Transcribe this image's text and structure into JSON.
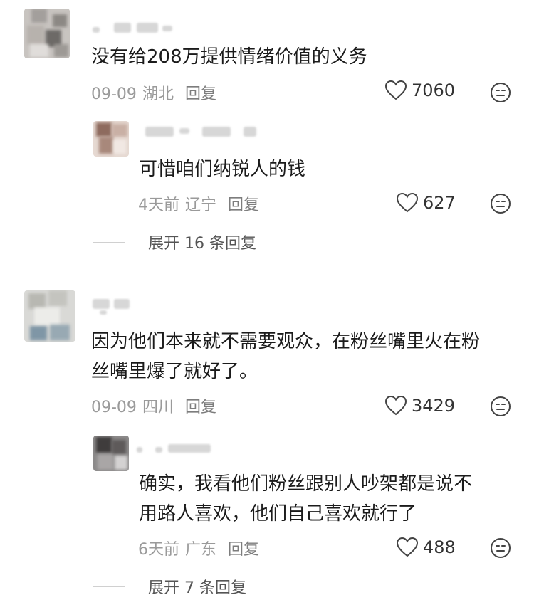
{
  "comments": [
    {
      "text": "没有给208万提供情绪价值的义务",
      "date": "09-09",
      "location": "湖北",
      "reply_label": "回复",
      "likes": "7060",
      "replies": [
        {
          "text": "可惜咱们纳锐人的钱",
          "date": "4天前",
          "location": "辽宁",
          "reply_label": "回复",
          "likes": "627"
        }
      ],
      "expand_label": "展开 16 条回复"
    },
    {
      "text_lines": [
        "因为他们本来就不需要观众，在粉丝嘴里火在粉",
        "丝嘴里爆了就好了。"
      ],
      "date": "09-09",
      "location": "四川",
      "reply_label": "回复",
      "likes": "3429",
      "replies": [
        {
          "text_lines": [
            "确实，我看他们粉丝跟别人吵架都是说不",
            "用路人喜欢，他们自己喜欢就行了"
          ],
          "date": "6天前",
          "location": "广东",
          "reply_label": "回复",
          "likes": "488"
        }
      ],
      "expand_label": "展开 7 条回复"
    }
  ],
  "icons": {
    "like": "heart-outline-icon",
    "react": "neutral-face-icon"
  },
  "colors": {
    "meta_gray": "#9a9a9a",
    "text_dark": "#1b1b1b"
  }
}
